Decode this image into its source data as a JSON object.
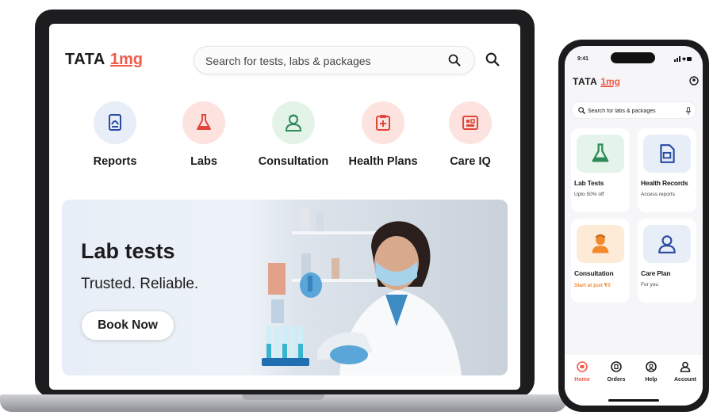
{
  "web": {
    "logo": {
      "tata": "TATA",
      "onemg": "1mg"
    },
    "search": {
      "placeholder": "Search for tests, labs & packages"
    },
    "categories": [
      {
        "label": "Reports",
        "icon": "report-icon",
        "bg": "#e8eef8",
        "color": "#2a4aa0"
      },
      {
        "label": "Labs",
        "icon": "flask-icon",
        "bg": "#fde3e0",
        "color": "#e2463b"
      },
      {
        "label": "Consultation",
        "icon": "doctor-icon",
        "bg": "#e3f3e8",
        "color": "#2e8b57"
      },
      {
        "label": "Health Plans",
        "icon": "clipboard-plus-icon",
        "bg": "#fde3e0",
        "color": "#e2463b"
      },
      {
        "label": "Care IQ",
        "icon": "care-board-icon",
        "bg": "#fde3e0",
        "color": "#e2463b"
      }
    ],
    "banner": {
      "title": "Lab tests",
      "subtitle": "Trusted. Reliable.",
      "cta": "Book Now"
    }
  },
  "phone": {
    "status_time": "9:41",
    "logo": {
      "tata": "TATA",
      "onemg": "1mg"
    },
    "search": {
      "placeholder": "Search for labs & packages"
    },
    "tiles": [
      {
        "title": "Lab Tests",
        "subtitle": "Upto 50% off",
        "icon": "flask-icon",
        "bg": "#e4f4ea",
        "color": "#2e8b57"
      },
      {
        "title": "Health Records",
        "subtitle": "Access reports",
        "icon": "document-icon",
        "bg": "#e8eef8",
        "color": "#2a4aa0"
      },
      {
        "title": "Consultation",
        "subtitle": "Start at just ₹0",
        "icon": "doctor-icon",
        "bg": "#fdebd8",
        "color": "#f28a2b"
      },
      {
        "title": "Care Plan",
        "subtitle": "For you",
        "icon": "person-icon",
        "bg": "#e8eef8",
        "color": "#2a4aa0"
      }
    ],
    "nav": [
      {
        "label": "Home",
        "icon": "home-icon",
        "active": true
      },
      {
        "label": "Orders",
        "icon": "orders-icon",
        "active": false
      },
      {
        "label": "Help",
        "icon": "help-icon",
        "active": false
      },
      {
        "label": "Account",
        "icon": "account-icon",
        "active": false
      }
    ]
  },
  "colors": {
    "brand_red": "#f05a4a",
    "accent_orange": "#f28a2b",
    "text_dark": "#1c1c1c"
  }
}
